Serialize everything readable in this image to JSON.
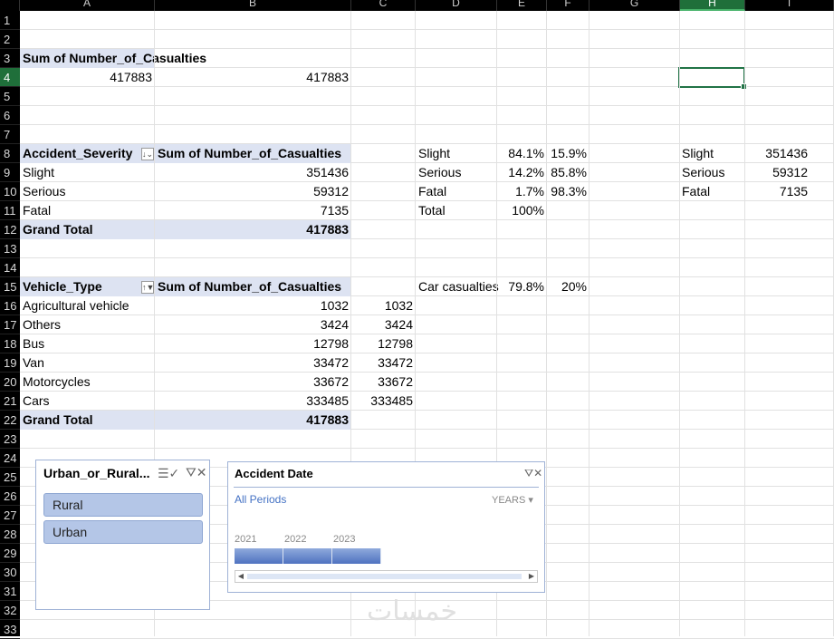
{
  "columns": [
    "A",
    "B",
    "C",
    "D",
    "E",
    "F",
    "G",
    "H",
    "I"
  ],
  "selected_column": "H",
  "rows": [
    "1",
    "2",
    "3",
    "4",
    "5",
    "6",
    "7",
    "8",
    "9",
    "10",
    "11",
    "12",
    "13",
    "14",
    "15",
    "16",
    "17",
    "18",
    "19",
    "20",
    "21",
    "22",
    "23",
    "24",
    "25",
    "26",
    "27",
    "28",
    "29",
    "30",
    "31",
    "32",
    "33"
  ],
  "selected_row": "4",
  "pivot1": {
    "header": "Sum of Number_of_Casualties",
    "value_a": "417883",
    "value_b": "417883"
  },
  "pivot2": {
    "row_label": "Accident_Severity",
    "value_label": "Sum of Number_of_Casualties",
    "rows": [
      {
        "label": "Slight",
        "value": "351436"
      },
      {
        "label": "Serious",
        "value": "59312"
      },
      {
        "label": "Fatal",
        "value": "7135"
      }
    ],
    "total_label": "Grand Total",
    "total_value": "417883"
  },
  "severity_pct": {
    "rows": [
      {
        "label": "Slight",
        "pct": "84.1%",
        "rest": "15.9%"
      },
      {
        "label": "Serious",
        "pct": "14.2%",
        "rest": "85.8%"
      },
      {
        "label": "Fatal",
        "pct": "1.7%",
        "rest": "98.3%"
      },
      {
        "label": "Total",
        "pct": "100%",
        "rest": ""
      }
    ]
  },
  "severity_copy": {
    "rows": [
      {
        "label": "Slight",
        "value": "351436"
      },
      {
        "label": "Serious",
        "value": "59312"
      },
      {
        "label": "Fatal",
        "value": "7135"
      }
    ]
  },
  "pivot3": {
    "row_label": "Vehicle_Type",
    "value_label": "Sum of Number_of_Casualties",
    "rows": [
      {
        "label": "Agricultural vehicle",
        "value": "1032",
        "copy": "1032"
      },
      {
        "label": "Others",
        "value": "3424",
        "copy": "3424"
      },
      {
        "label": "Bus",
        "value": "12798",
        "copy": "12798"
      },
      {
        "label": "Van",
        "value": "33472",
        "copy": "33472"
      },
      {
        "label": "Motorcycles",
        "value": "33672",
        "copy": "33672"
      },
      {
        "label": "Cars",
        "value": "333485",
        "copy": "333485"
      }
    ],
    "total_label": "Grand Total",
    "total_value": "417883"
  },
  "car_casualties": {
    "label": "Car casualties",
    "pct": "79.8%",
    "rest": "20%"
  },
  "slicer": {
    "title": "Urban_or_Rural...",
    "items": [
      "Rural",
      "Urban"
    ],
    "icons": [
      "multi-select-icon",
      "clear-filter-icon"
    ]
  },
  "timeline": {
    "title": "Accident Date",
    "periods_link": "All Periods",
    "level": "YEARS",
    "years": [
      "2021",
      "2022",
      "2023"
    ]
  },
  "watermark": "خمسات",
  "colors": {
    "pivot_header": "#dde3f2",
    "selection": "#217346",
    "slicer_item": "#b4c6e7"
  }
}
